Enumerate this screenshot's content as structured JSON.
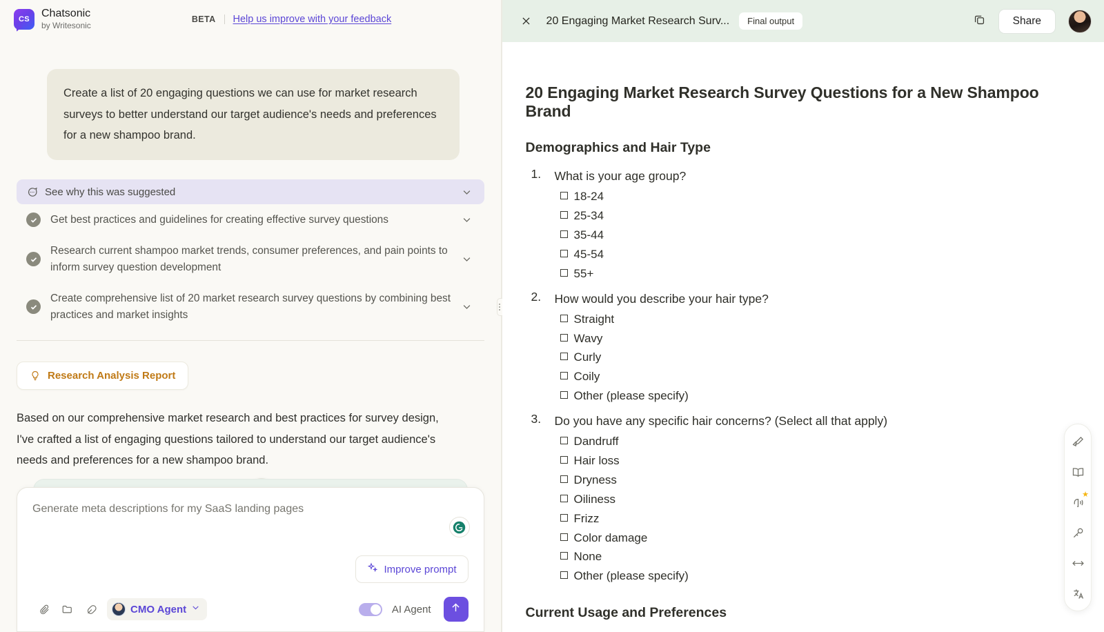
{
  "left_header": {
    "logo_text": "CS",
    "brand_title": "Chatsonic",
    "brand_subtitle": "by Writesonic",
    "beta_label": "BETA",
    "feedback_link": "Help us improve with your feedback"
  },
  "conversation": {
    "user_message": "Create a list of 20 engaging questions we can use for market research surveys to better understand our target audience's needs and preferences for a new shampoo brand.",
    "suggestion_bar": {
      "label": "See why this was suggested",
      "icon": "chat-bubble-icon",
      "chevron": "chevron-down-icon"
    },
    "tasks": [
      {
        "label": "Get best practices and guidelines for creating effective survey questions",
        "status": "done"
      },
      {
        "label": "Research current shampoo market trends, consumer preferences, and pain points to inform survey question development",
        "status": "done"
      },
      {
        "label": "Create comprehensive list of 20 market research survey questions by combining best practices and market insights",
        "status": "done"
      }
    ],
    "report_chip": {
      "label": "Research Analysis Report",
      "icon": "lightbulb-icon",
      "color": "#c07a16"
    },
    "report_body": "Based on our comprehensive market research and best practices for survey design, I've crafted a list of engaging questions tailored to understand our target audience's needs and preferences for a new shampoo brand.",
    "scroll_down_icon": "arrow-down-icon"
  },
  "composer": {
    "placeholder": "Generate meta descriptions for my SaaS landing pages",
    "value": "",
    "grammarly_icon": "grammarly-icon",
    "improve_prompt_label": "Improve prompt",
    "improve_prompt_icon": "sparkle-icon",
    "tools": [
      {
        "name": "attach-icon"
      },
      {
        "name": "folder-icon"
      },
      {
        "name": "feather-icon"
      }
    ],
    "agent_chip": {
      "label": "CMO Agent",
      "chevron": "chevron-down-icon"
    },
    "ai_agent_toggle": {
      "label": "AI Agent",
      "state": "on"
    },
    "send_icon": "arrow-up-icon"
  },
  "right_header": {
    "close_icon": "close-icon",
    "title": "20 Engaging Market Research Surv...",
    "badge": "Final output",
    "copy_icon": "copy-icon",
    "share_label": "Share",
    "avatar": "user-avatar"
  },
  "document": {
    "title": "20 Engaging Market Research Survey Questions for a New Shampoo Brand",
    "sections": [
      {
        "heading": "Demographics and Hair Type",
        "questions": [
          {
            "number": 1,
            "text": "What is your age group?",
            "options": [
              "18-24",
              "25-34",
              "35-44",
              "45-54",
              "55+"
            ]
          },
          {
            "number": 2,
            "text": "How would you describe your hair type?",
            "options": [
              "Straight",
              "Wavy",
              "Curly",
              "Coily",
              "Other (please specify)"
            ]
          },
          {
            "number": 3,
            "text": "Do you have any specific hair concerns? (Select all that apply)",
            "options": [
              "Dandruff",
              "Hair loss",
              "Dryness",
              "Oiliness",
              "Frizz",
              "Color damage",
              "None",
              "Other (please specify)"
            ]
          }
        ]
      },
      {
        "heading": "Current Usage and Preferences",
        "questions": []
      }
    ]
  },
  "floating_toolbar": [
    {
      "name": "brush-icon",
      "badge": null
    },
    {
      "name": "book-icon",
      "badge": null
    },
    {
      "name": "listen-icon",
      "badge": "star"
    },
    {
      "name": "microphone-icon",
      "badge": null
    },
    {
      "name": "resize-horizontal-icon",
      "badge": null
    },
    {
      "name": "translate-icon",
      "badge": null
    }
  ],
  "colors": {
    "accent_purple": "#5b46d6",
    "accent_orange": "#c07a16",
    "header_green": "#e7f0e7",
    "bubble_beige": "#eceade",
    "suggest_lavender": "#e6e3f3"
  }
}
